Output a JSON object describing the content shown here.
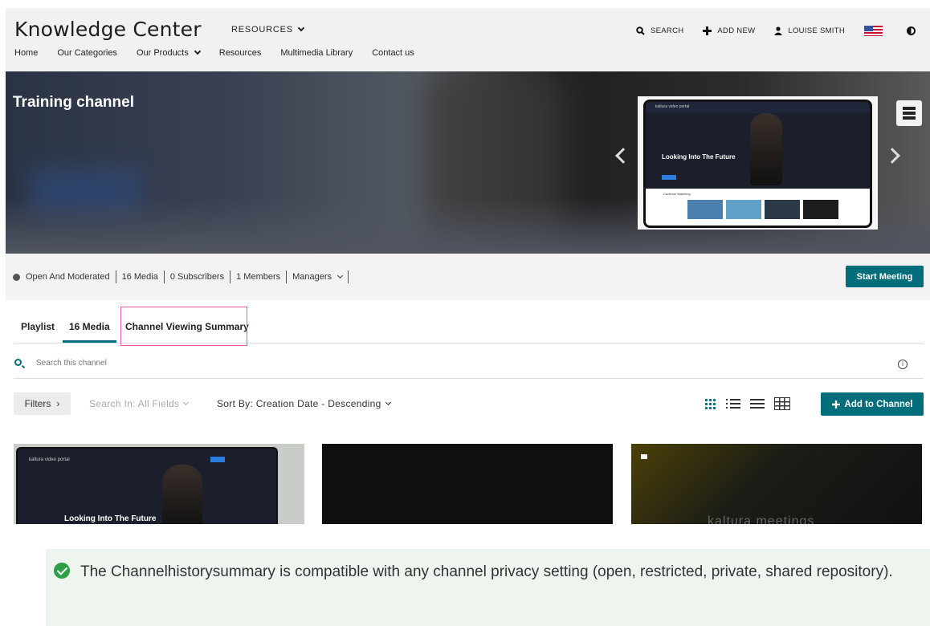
{
  "header": {
    "brand": "Knowledge Center",
    "resources_menu": "RESOURCES",
    "nav": [
      "Home",
      "Our Categories",
      "Our Products",
      "Resources",
      "Multimedia Library",
      "Contact us"
    ],
    "search_label": "SEARCH",
    "add_new_label": "ADD NEW",
    "user_label": "LOUISE SMITH"
  },
  "banner": {
    "title": "Training channel",
    "slide_title": "Looking Into The Future",
    "slide_logo": "kaltura video portal",
    "slide_strip_label": "Continue Watching"
  },
  "channel_info": {
    "privacy": "Open And Moderated",
    "media": "16  Media",
    "subscribers": "0  Subscribers",
    "members": "1  Members",
    "managers": "Managers",
    "start_meeting": "Start Meeting"
  },
  "tabs": {
    "playlist": "Playlist",
    "media": "16 Media",
    "summary": "Channel Viewing Summary"
  },
  "search": {
    "placeholder": "Search this channel"
  },
  "toolbar": {
    "filters": "Filters",
    "search_in": "Search In: All Fields",
    "sort_by": "Sort By: Creation Date - Descending",
    "add_to_channel": "Add to Channel"
  },
  "media_cards": [
    {
      "title": "Looking Into The Future",
      "logo": "kaltura video portal"
    },
    {
      "title": ""
    },
    {
      "watermark": "kaltura meetings"
    }
  ],
  "note": {
    "text": "The Channelhistorysummary is compatible with any channel privacy setting (open, restricted, private, shared repository)."
  },
  "colors": {
    "accent": "#006e7a",
    "highlight": "#e05fb0",
    "success": "#2e9f46"
  }
}
